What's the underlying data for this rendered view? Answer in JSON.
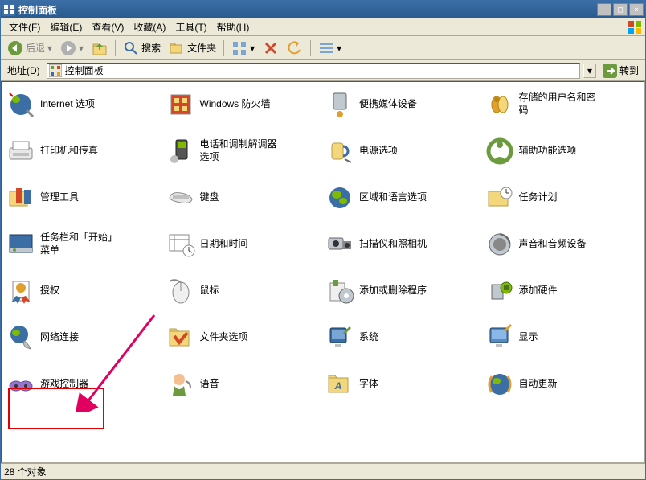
{
  "title": "控制面板",
  "menus": {
    "file": "文件(F)",
    "edit": "编辑(E)",
    "view": "查看(V)",
    "fav": "收藏(A)",
    "tools": "工具(T)",
    "help": "帮助(H)"
  },
  "toolbar": {
    "back": "后退",
    "search": "搜索",
    "folders": "文件夹"
  },
  "address": {
    "label": "地址(D)",
    "value": "控制面板",
    "go": "转到"
  },
  "items": [
    {
      "label": "Internet 选项"
    },
    {
      "label": "Windows 防火墙"
    },
    {
      "label": "便携媒体设备"
    },
    {
      "label": "存储的用户名和密码"
    },
    {
      "label": "打印机和传真"
    },
    {
      "label": "电话和调制解调器选项"
    },
    {
      "label": "电源选项"
    },
    {
      "label": "辅助功能选项"
    },
    {
      "label": "管理工具"
    },
    {
      "label": "键盘"
    },
    {
      "label": "区域和语言选项"
    },
    {
      "label": "任务计划"
    },
    {
      "label": "任务栏和「开始」菜单"
    },
    {
      "label": "日期和时间"
    },
    {
      "label": "扫描仪和照相机"
    },
    {
      "label": "声音和音频设备"
    },
    {
      "label": "授权"
    },
    {
      "label": "鼠标"
    },
    {
      "label": "添加或删除程序"
    },
    {
      "label": "添加硬件"
    },
    {
      "label": "网络连接"
    },
    {
      "label": "文件夹选项"
    },
    {
      "label": "系统"
    },
    {
      "label": "显示"
    },
    {
      "label": "游戏控制器"
    },
    {
      "label": "语音"
    },
    {
      "label": "字体"
    },
    {
      "label": "自动更新"
    }
  ],
  "statusbar": "28 个对象",
  "placeholder_row4": ""
}
